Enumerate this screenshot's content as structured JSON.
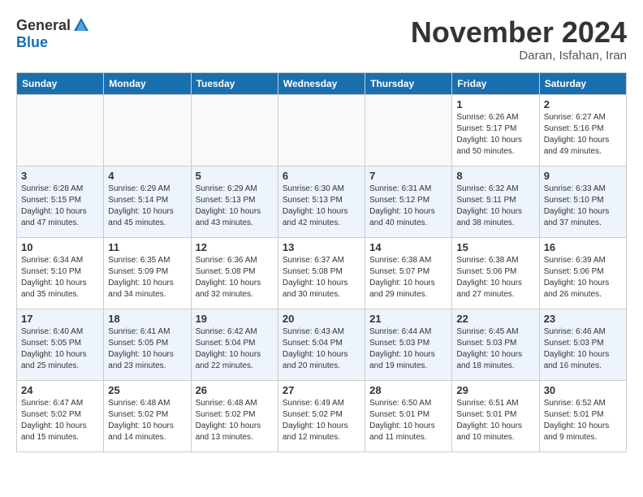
{
  "header": {
    "logo_general": "General",
    "logo_blue": "Blue",
    "month_title": "November 2024",
    "subtitle": "Daran, Isfahan, Iran"
  },
  "weekdays": [
    "Sunday",
    "Monday",
    "Tuesday",
    "Wednesday",
    "Thursday",
    "Friday",
    "Saturday"
  ],
  "weeks": [
    [
      {
        "day": "",
        "info": ""
      },
      {
        "day": "",
        "info": ""
      },
      {
        "day": "",
        "info": ""
      },
      {
        "day": "",
        "info": ""
      },
      {
        "day": "",
        "info": ""
      },
      {
        "day": "1",
        "info": "Sunrise: 6:26 AM\nSunset: 5:17 PM\nDaylight: 10 hours\nand 50 minutes."
      },
      {
        "day": "2",
        "info": "Sunrise: 6:27 AM\nSunset: 5:16 PM\nDaylight: 10 hours\nand 49 minutes."
      }
    ],
    [
      {
        "day": "3",
        "info": "Sunrise: 6:28 AM\nSunset: 5:15 PM\nDaylight: 10 hours\nand 47 minutes."
      },
      {
        "day": "4",
        "info": "Sunrise: 6:29 AM\nSunset: 5:14 PM\nDaylight: 10 hours\nand 45 minutes."
      },
      {
        "day": "5",
        "info": "Sunrise: 6:29 AM\nSunset: 5:13 PM\nDaylight: 10 hours\nand 43 minutes."
      },
      {
        "day": "6",
        "info": "Sunrise: 6:30 AM\nSunset: 5:13 PM\nDaylight: 10 hours\nand 42 minutes."
      },
      {
        "day": "7",
        "info": "Sunrise: 6:31 AM\nSunset: 5:12 PM\nDaylight: 10 hours\nand 40 minutes."
      },
      {
        "day": "8",
        "info": "Sunrise: 6:32 AM\nSunset: 5:11 PM\nDaylight: 10 hours\nand 38 minutes."
      },
      {
        "day": "9",
        "info": "Sunrise: 6:33 AM\nSunset: 5:10 PM\nDaylight: 10 hours\nand 37 minutes."
      }
    ],
    [
      {
        "day": "10",
        "info": "Sunrise: 6:34 AM\nSunset: 5:10 PM\nDaylight: 10 hours\nand 35 minutes."
      },
      {
        "day": "11",
        "info": "Sunrise: 6:35 AM\nSunset: 5:09 PM\nDaylight: 10 hours\nand 34 minutes."
      },
      {
        "day": "12",
        "info": "Sunrise: 6:36 AM\nSunset: 5:08 PM\nDaylight: 10 hours\nand 32 minutes."
      },
      {
        "day": "13",
        "info": "Sunrise: 6:37 AM\nSunset: 5:08 PM\nDaylight: 10 hours\nand 30 minutes."
      },
      {
        "day": "14",
        "info": "Sunrise: 6:38 AM\nSunset: 5:07 PM\nDaylight: 10 hours\nand 29 minutes."
      },
      {
        "day": "15",
        "info": "Sunrise: 6:38 AM\nSunset: 5:06 PM\nDaylight: 10 hours\nand 27 minutes."
      },
      {
        "day": "16",
        "info": "Sunrise: 6:39 AM\nSunset: 5:06 PM\nDaylight: 10 hours\nand 26 minutes."
      }
    ],
    [
      {
        "day": "17",
        "info": "Sunrise: 6:40 AM\nSunset: 5:05 PM\nDaylight: 10 hours\nand 25 minutes."
      },
      {
        "day": "18",
        "info": "Sunrise: 6:41 AM\nSunset: 5:05 PM\nDaylight: 10 hours\nand 23 minutes."
      },
      {
        "day": "19",
        "info": "Sunrise: 6:42 AM\nSunset: 5:04 PM\nDaylight: 10 hours\nand 22 minutes."
      },
      {
        "day": "20",
        "info": "Sunrise: 6:43 AM\nSunset: 5:04 PM\nDaylight: 10 hours\nand 20 minutes."
      },
      {
        "day": "21",
        "info": "Sunrise: 6:44 AM\nSunset: 5:03 PM\nDaylight: 10 hours\nand 19 minutes."
      },
      {
        "day": "22",
        "info": "Sunrise: 6:45 AM\nSunset: 5:03 PM\nDaylight: 10 hours\nand 18 minutes."
      },
      {
        "day": "23",
        "info": "Sunrise: 6:46 AM\nSunset: 5:03 PM\nDaylight: 10 hours\nand 16 minutes."
      }
    ],
    [
      {
        "day": "24",
        "info": "Sunrise: 6:47 AM\nSunset: 5:02 PM\nDaylight: 10 hours\nand 15 minutes."
      },
      {
        "day": "25",
        "info": "Sunrise: 6:48 AM\nSunset: 5:02 PM\nDaylight: 10 hours\nand 14 minutes."
      },
      {
        "day": "26",
        "info": "Sunrise: 6:48 AM\nSunset: 5:02 PM\nDaylight: 10 hours\nand 13 minutes."
      },
      {
        "day": "27",
        "info": "Sunrise: 6:49 AM\nSunset: 5:02 PM\nDaylight: 10 hours\nand 12 minutes."
      },
      {
        "day": "28",
        "info": "Sunrise: 6:50 AM\nSunset: 5:01 PM\nDaylight: 10 hours\nand 11 minutes."
      },
      {
        "day": "29",
        "info": "Sunrise: 6:51 AM\nSunset: 5:01 PM\nDaylight: 10 hours\nand 10 minutes."
      },
      {
        "day": "30",
        "info": "Sunrise: 6:52 AM\nSunset: 5:01 PM\nDaylight: 10 hours\nand 9 minutes."
      }
    ]
  ]
}
